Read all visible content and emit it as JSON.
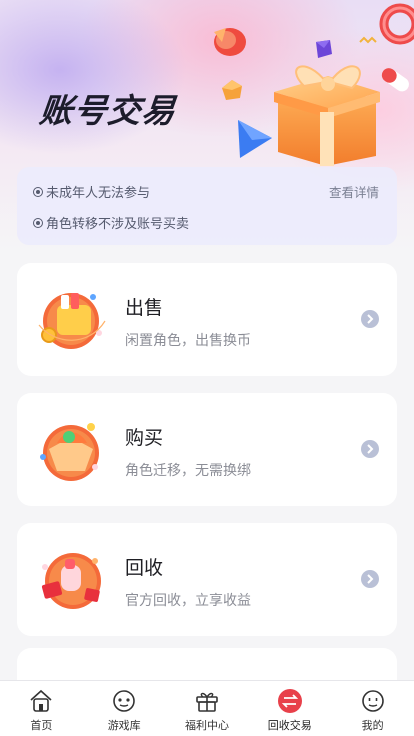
{
  "hero": {
    "title": "账号交易"
  },
  "notice": {
    "lines": [
      "未成年人无法参与",
      "角色转移不涉及账号买卖"
    ],
    "detail_link": "查看详情"
  },
  "cards": [
    {
      "title": "出售",
      "subtitle": "闲置角色，出售换币",
      "icon": "sell-icon"
    },
    {
      "title": "购买",
      "subtitle": "角色迁移，无需换绑",
      "icon": "buy-icon"
    },
    {
      "title": "回收",
      "subtitle": "官方回收，立享收益",
      "icon": "recycle-icon"
    }
  ],
  "tabbar": {
    "items": [
      {
        "label": "首页",
        "icon": "home-icon"
      },
      {
        "label": "游戏库",
        "icon": "game-library-icon"
      },
      {
        "label": "福利中心",
        "icon": "gift-icon"
      },
      {
        "label": "回收交易",
        "icon": "exchange-icon",
        "active": true
      },
      {
        "label": "我的",
        "icon": "profile-icon"
      }
    ]
  },
  "colors": {
    "accent": "#e8404a",
    "arrow": "#b9c0d6",
    "background": "#f5f5f7"
  }
}
